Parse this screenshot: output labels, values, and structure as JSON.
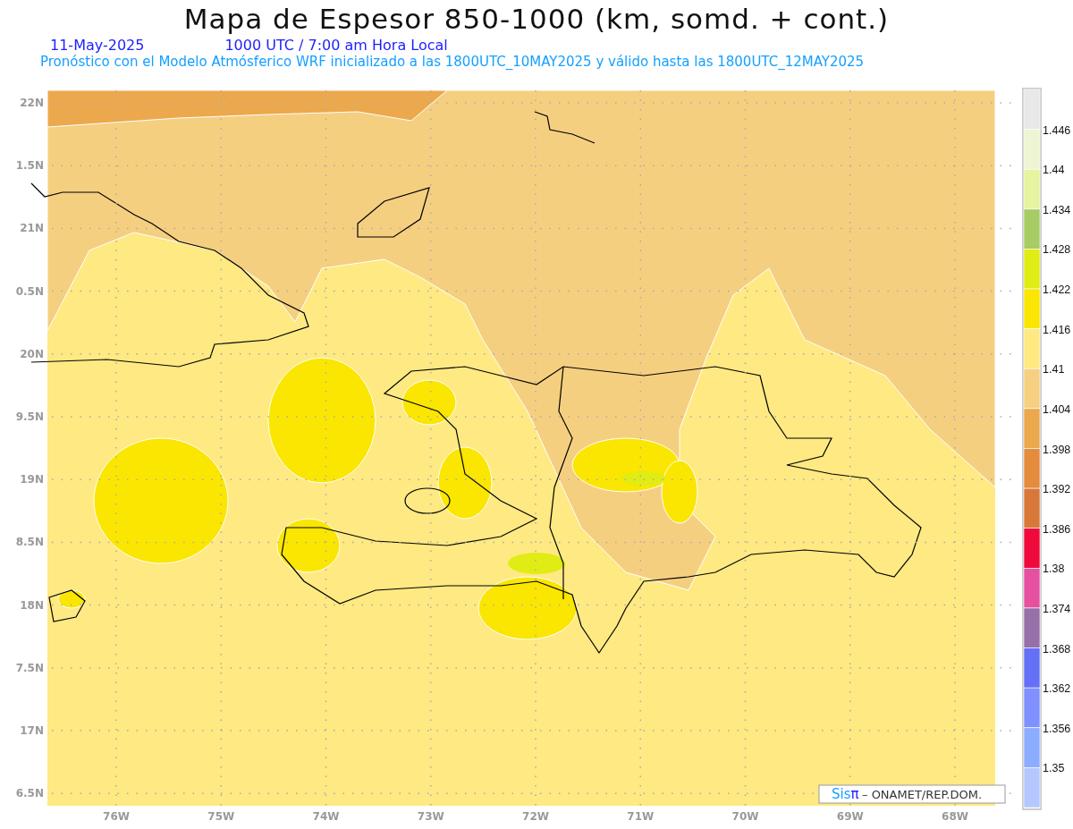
{
  "title": "Mapa de Espesor 850-1000 (km, somd. + cont.)",
  "date": "11-May-2025",
  "time": "1000 UTC / 7:00 am Hora Local",
  "forecast": "Pronóstico con el Modelo Atmósferico WRF inicializado a las 1800UTC_10MAY2025 y válido hasta las  1800UTC_12MAY2025",
  "map": {
    "y_labels": [
      "22N",
      "1.5N",
      "21N",
      "0.5N",
      "20N",
      "9.5N",
      "19N",
      "8.5N",
      "18N",
      "7.5N",
      "17N",
      "6.5N"
    ],
    "x_labels": [
      "76W",
      "75W",
      "74W",
      "73W",
      "72W",
      "71W",
      "70W",
      "69W",
      "68W"
    ]
  },
  "colorbar": {
    "bins": [
      {
        "color": "#e8e8e8"
      },
      {
        "color": "#eef5d2"
      },
      {
        "color": "#e6f4a0"
      },
      {
        "color": "#a8cc64"
      },
      {
        "color": "#e0ec14"
      },
      {
        "color": "#fae600"
      },
      {
        "color": "#ffe980"
      },
      {
        "color": "#f5d080"
      },
      {
        "color": "#eca84c"
      },
      {
        "color": "#e48c3c"
      },
      {
        "color": "#d87838"
      },
      {
        "color": "#f00a3c"
      },
      {
        "color": "#e650a0"
      },
      {
        "color": "#9670a8"
      },
      {
        "color": "#6470f5"
      },
      {
        "color": "#8090ff"
      },
      {
        "color": "#8cacff"
      },
      {
        "color": "#b4c8ff"
      }
    ],
    "labels": [
      "1.446",
      "1.44",
      "1.434",
      "1.428",
      "1.422",
      "1.416",
      "1.41",
      "1.404",
      "1.398",
      "1.392",
      "1.386",
      "1.38",
      "1.374",
      "1.368",
      "1.362",
      "1.356",
      "1.35"
    ]
  },
  "credit": {
    "logo_part_1": "Sis",
    "logo_part_2": "π",
    "text": "– ONAMET/REP.DOM."
  }
}
